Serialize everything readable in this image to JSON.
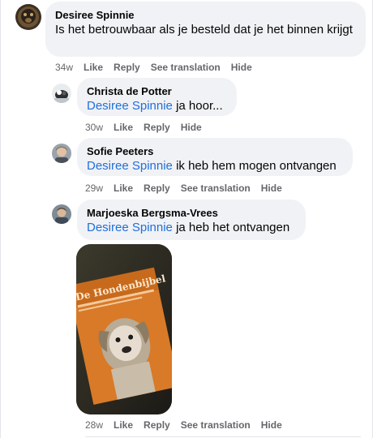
{
  "comments": [
    {
      "author": "Desiree Spinnie",
      "mention": "",
      "text": "Is het betrouwbaar als je besteld dat je het binnen krijgt",
      "age": "34w",
      "like": "Like",
      "reply": "Reply",
      "translate": "See translation",
      "hide": "Hide"
    },
    {
      "author": "Christa de Potter",
      "mention": "Desiree Spinnie",
      "text": "ja hoor...",
      "age": "30w",
      "like": "Like",
      "reply": "Reply",
      "hide": "Hide"
    },
    {
      "author": "Sofie Peeters",
      "mention": "Desiree Spinnie",
      "text": "ik heb hem mogen ontvangen",
      "age": "29w",
      "like": "Like",
      "reply": "Reply",
      "translate": "See translation",
      "hide": "Hide"
    },
    {
      "author": "Marjoeska Bergsma-Vrees",
      "mention": "Desiree Spinnie",
      "text": "ja heb het ontvangen",
      "age": "28w",
      "like": "Like",
      "reply": "Reply",
      "translate": "See translation",
      "hide": "Hide"
    }
  ],
  "attachment": {
    "book_title": "De Hondenbijbel"
  },
  "colors": {
    "bubble": "#f0f2f5",
    "mention": "#216fdb",
    "meta": "#65676b"
  }
}
